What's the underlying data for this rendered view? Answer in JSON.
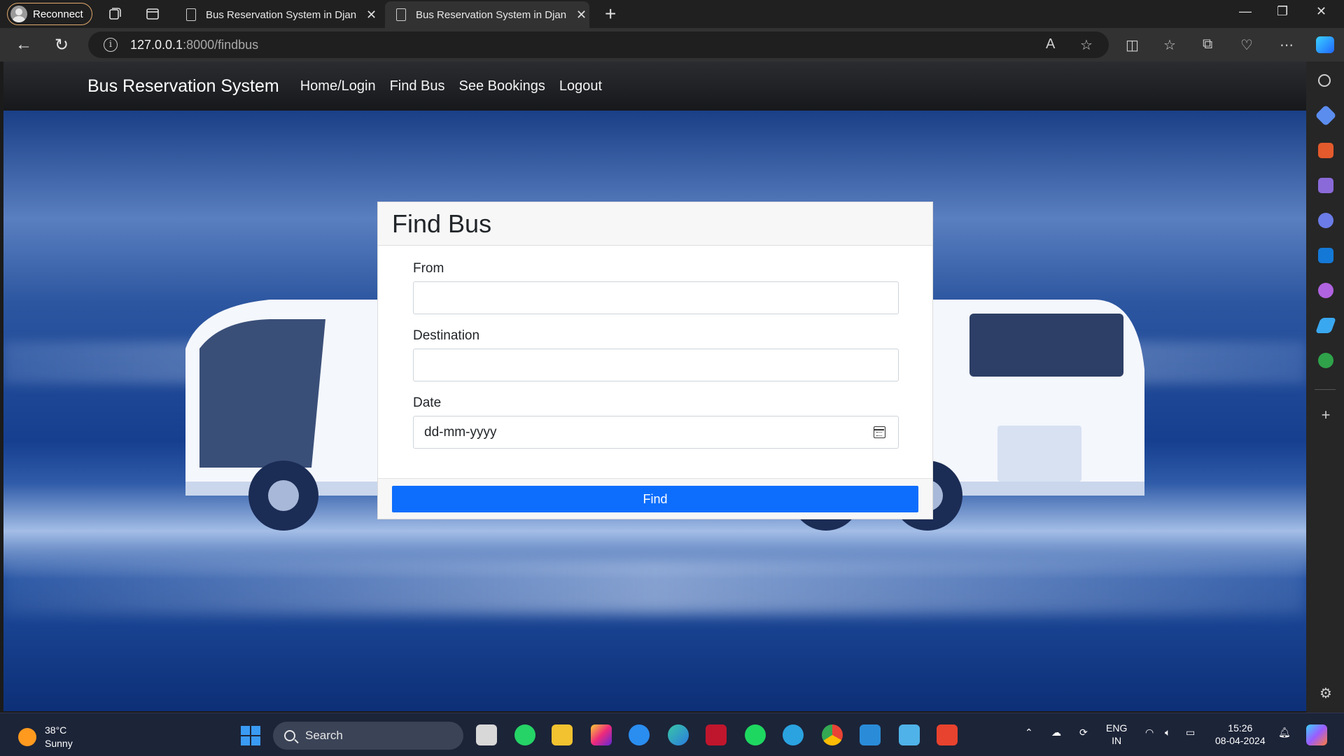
{
  "browser": {
    "profile_label": "Reconnect",
    "tabs": [
      {
        "label": "Bus Reservation System in Django"
      },
      {
        "label": "Bus Reservation System in Django"
      }
    ],
    "url_host": "127.0.0.1",
    "url_path": ":8000/findbus"
  },
  "site": {
    "brand": "Bus Reservation System",
    "nav": [
      "Home/Login",
      "Find Bus",
      "See Bookings",
      "Logout"
    ]
  },
  "form": {
    "title": "Find Bus",
    "from_label": "From",
    "from_value": "",
    "destination_label": "Destination",
    "destination_value": "",
    "date_label": "Date",
    "date_placeholder": "dd-mm-yyyy",
    "submit_label": "Find"
  },
  "taskbar": {
    "temperature": "38°C",
    "weather": "Sunny",
    "search_label": "Search",
    "lang_primary": "ENG",
    "lang_secondary": "IN",
    "time": "15:26",
    "date": "08-04-2024"
  },
  "colors": {
    "primary_button": "#0d6efd",
    "navbar": "#212529",
    "hero_tint": "#1a4590"
  }
}
